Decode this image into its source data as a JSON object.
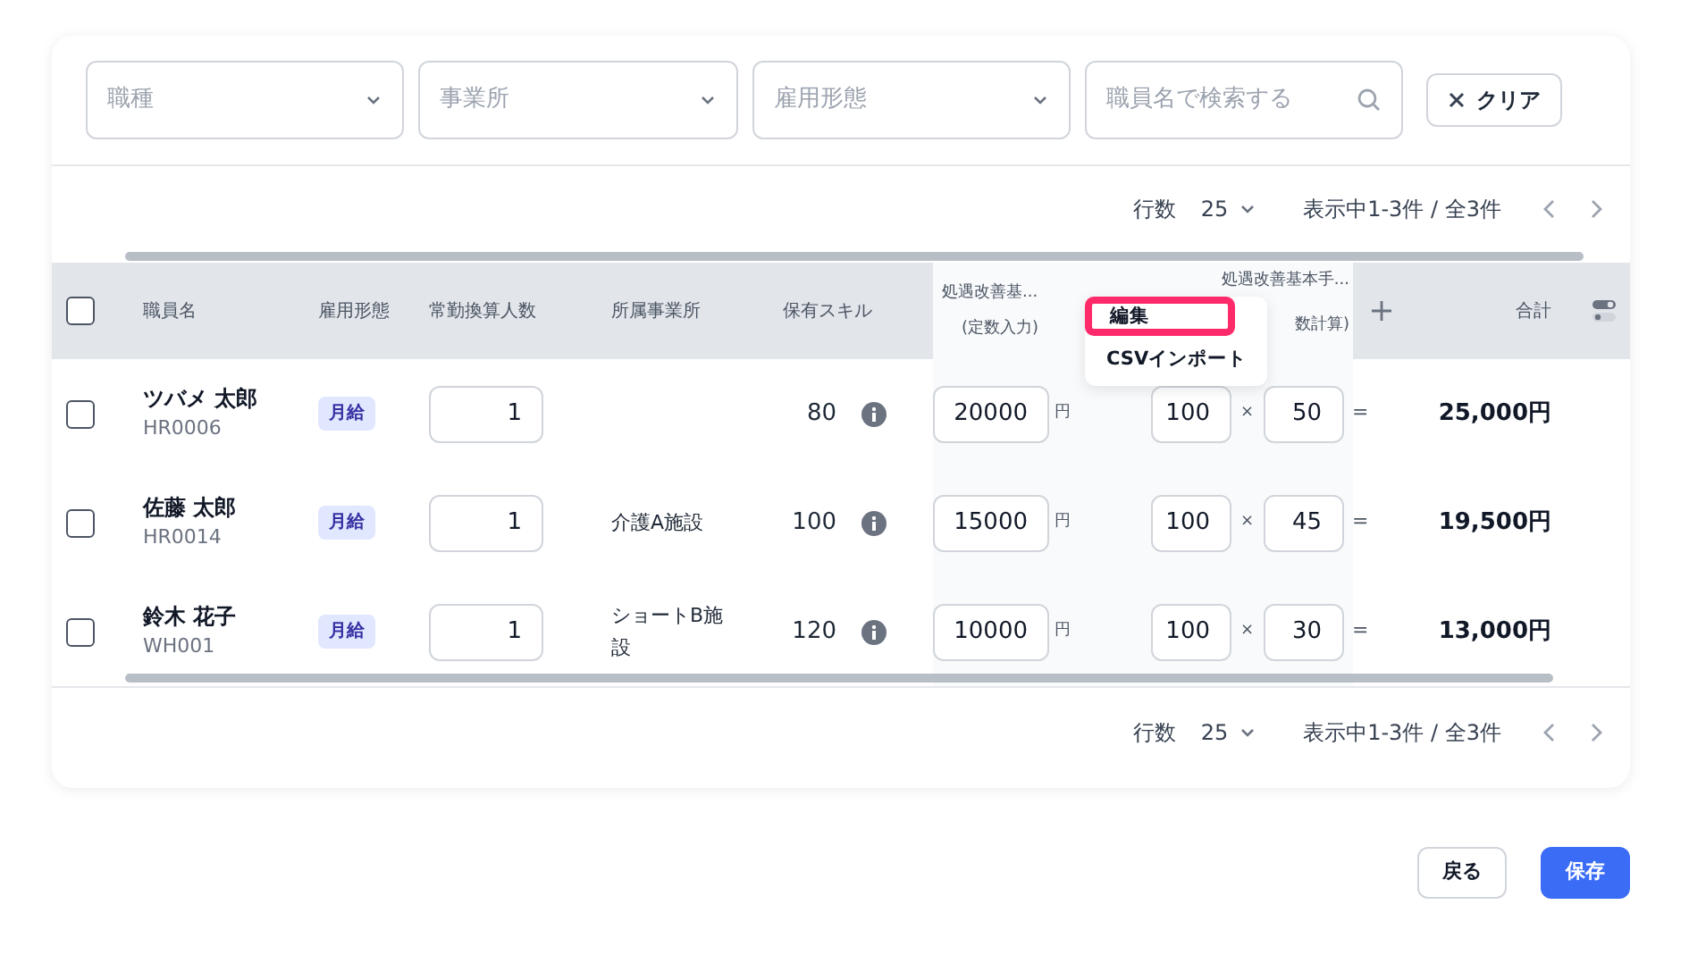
{
  "filters": [
    {
      "kind": "select",
      "placeholder": "職種"
    },
    {
      "kind": "select",
      "placeholder": "事業所"
    },
    {
      "kind": "select",
      "placeholder": "雇用形態"
    },
    {
      "kind": "search",
      "placeholder": "職員名で検索する"
    }
  ],
  "clear_button": "クリア",
  "pagination_top": {
    "rows_label": "行数",
    "rows_value": "25",
    "range": "表示中1-3件 / 全3件"
  },
  "table": {
    "select_all_checked": false,
    "columns": [
      "職員名",
      "雇用形態",
      "常勤換算人数",
      "所属事業所",
      "保有スキル"
    ],
    "fixed_column": {
      "title": "処遇改善基...",
      "subtitle": "(定数入力)"
    },
    "calc_column": {
      "title": "処遇改善基本手...",
      "subtitle": "数計算)"
    },
    "total_column": "合計",
    "rows": [
      {
        "checked": false,
        "name": "ツバメ 太郎",
        "code": "HR0006",
        "employment": "月給",
        "fte": "1",
        "office": "",
        "skill": "80",
        "base": "20000",
        "unit": "円",
        "rate": "100",
        "times": "×",
        "count": "50",
        "equals": "=",
        "total": "25,000円"
      },
      {
        "checked": false,
        "name": "佐藤 太郎",
        "code": "HR0014",
        "employment": "月給",
        "fte": "1",
        "office": "介護A施設",
        "skill": "100",
        "base": "15000",
        "unit": "円",
        "rate": "100",
        "times": "×",
        "count": "45",
        "equals": "=",
        "total": "19,500円"
      },
      {
        "checked": false,
        "name": "鈴木 花子",
        "code": "WH001",
        "employment": "月給",
        "fte": "1",
        "office": "ショートB施設",
        "skill": "120",
        "base": "10000",
        "unit": "円",
        "rate": "100",
        "times": "×",
        "count": "30",
        "equals": "=",
        "total": "13,000円"
      }
    ]
  },
  "column_menu": {
    "items": [
      {
        "label": "編集",
        "selected": true
      },
      {
        "label": "CSVインポート",
        "selected": false
      }
    ]
  },
  "pagination_bottom": {
    "rows_label": "行数",
    "rows_value": "25",
    "range": "表示中1-3件 / 全3件"
  },
  "buttons": [
    {
      "kind": "secondary",
      "label": "戻る"
    },
    {
      "kind": "primary",
      "label": "保存"
    }
  ]
}
